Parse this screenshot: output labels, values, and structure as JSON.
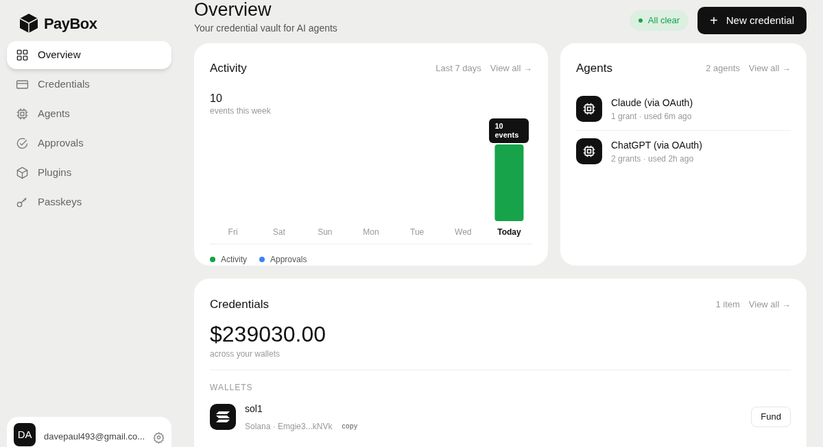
{
  "brand": {
    "name": "PayBox"
  },
  "sidebar": {
    "items": [
      {
        "label": "Overview",
        "kind": "grid",
        "selected": true
      },
      {
        "label": "Credentials",
        "kind": "card",
        "selected": false
      },
      {
        "label": "Agents",
        "kind": "chip",
        "selected": false
      },
      {
        "label": "Approvals",
        "kind": "check",
        "selected": false
      },
      {
        "label": "Plugins",
        "kind": "cube",
        "selected": false
      },
      {
        "label": "Passkeys",
        "kind": "key",
        "selected": false
      }
    ],
    "user": {
      "initials": "DA",
      "email": "davepaul493@gmail.co..."
    }
  },
  "header": {
    "title": "Overview",
    "subtitle": "Your credential vault for AI agents",
    "status": {
      "label": "All clear",
      "color": "#16a34a"
    },
    "primary_button": {
      "icon": "+",
      "label": "New credential"
    }
  },
  "activity": {
    "title": "Activity",
    "range": "Last 7 days",
    "link": "View all →",
    "total": "10",
    "total_caption": "events this week",
    "tooltip_unit": "events",
    "chart_data": {
      "type": "bar",
      "categories": [
        "Fri",
        "Sat",
        "Sun",
        "Mon",
        "Tue",
        "Wed",
        "Today"
      ],
      "values": [
        null,
        null,
        null,
        null,
        null,
        null,
        10
      ],
      "data_labels": true
    },
    "legend": [
      {
        "label": "Activity",
        "color": "#16a34a"
      },
      {
        "label": "Approvals",
        "color": "#3b82f6"
      }
    ]
  },
  "agents": {
    "title": "Agents",
    "count": "2 agents",
    "link": "View all →",
    "items": [
      {
        "name": "Claude (via OAuth)",
        "detail": "1 grant · used 6m ago"
      },
      {
        "name": "ChatGPT (via OAuth)",
        "detail": "2 grants · used 2h ago"
      }
    ]
  },
  "credentials": {
    "title": "Credentials",
    "count": "1 item",
    "link": "View all →",
    "amount": "$239030.00",
    "amount_caption": "across your wallets",
    "section_label": "WALLETS",
    "wallets": [
      {
        "name": "sol1",
        "detail": "Solana · Emgie3...kNVk",
        "copy": "copy",
        "action": "Fund"
      }
    ]
  }
}
